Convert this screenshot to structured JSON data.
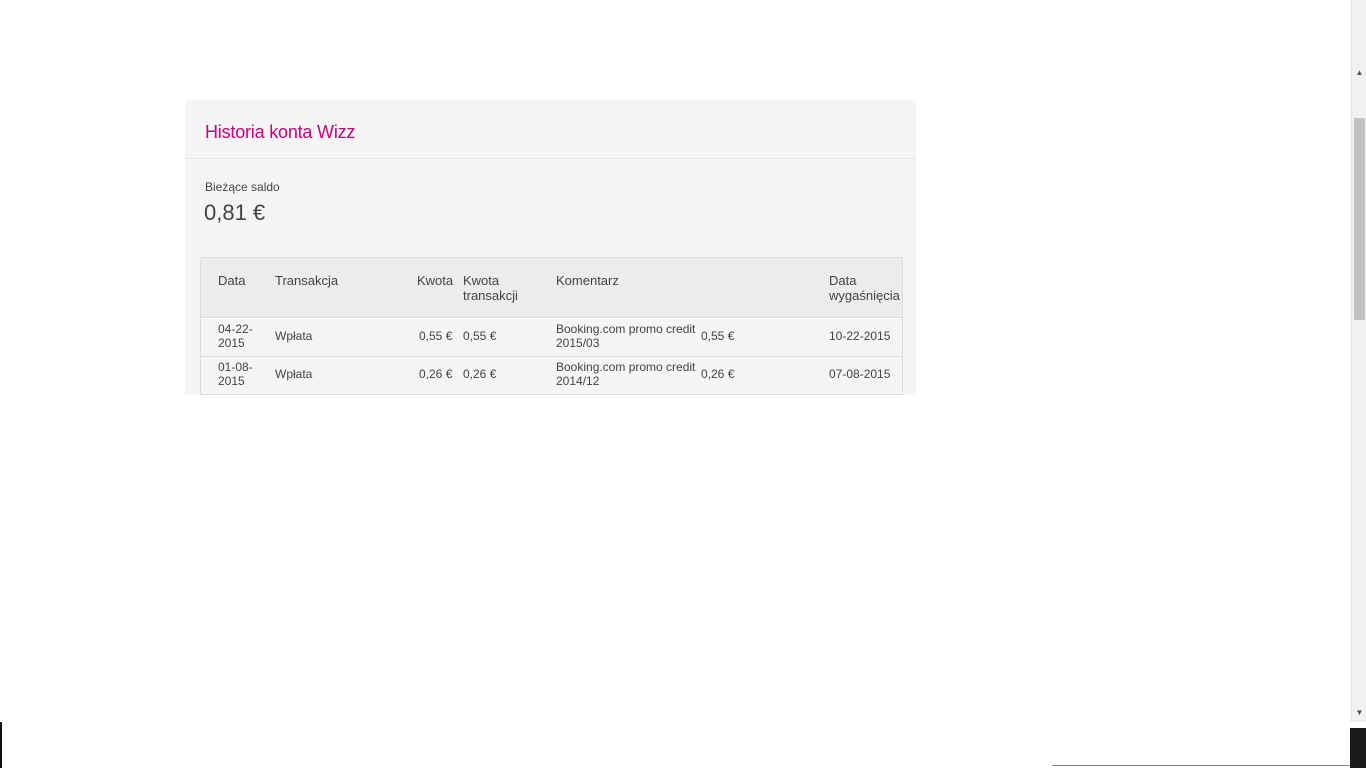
{
  "page": {
    "title": "Historia konta Wizz",
    "balance_label": "Bieżące saldo",
    "balance_value": "0,81 €"
  },
  "table": {
    "headers": {
      "date": "Data",
      "transaction": "Transakcja",
      "amount": "Kwota",
      "transaction_amount_line1": "Kwota",
      "transaction_amount_line2": "transakcji",
      "comment": "Komentarz",
      "expiry_line1": "Data",
      "expiry_line2": "wygaśnięcia"
    },
    "rows": [
      {
        "date_line1": "04-22-",
        "date_line2": "2015",
        "transaction": "Wpłata",
        "amount": "0,55 €",
        "transaction_amount": "0,55 €",
        "comment_line1": "Booking.com promo credit",
        "comment_line2": "2015/03",
        "extra_amount": "0,55 €",
        "expiry": "10-22-2015"
      },
      {
        "date_line1": "01-08-",
        "date_line2": "2015",
        "transaction": "Wpłata",
        "amount": "0,26 €",
        "transaction_amount": "0,26 €",
        "comment_line1": "Booking.com promo credit",
        "comment_line2": "2014/12",
        "extra_amount": "0,26 €",
        "expiry": "07-08-2015"
      }
    ]
  },
  "colors": {
    "accent": "#c6007e",
    "card_bg": "#f5f5f5",
    "header_bg": "#ececec"
  },
  "icons": {
    "menu": "menu-icon",
    "scroll_up": "arrow-up-icon",
    "scroll_down": "arrow-down-icon"
  }
}
